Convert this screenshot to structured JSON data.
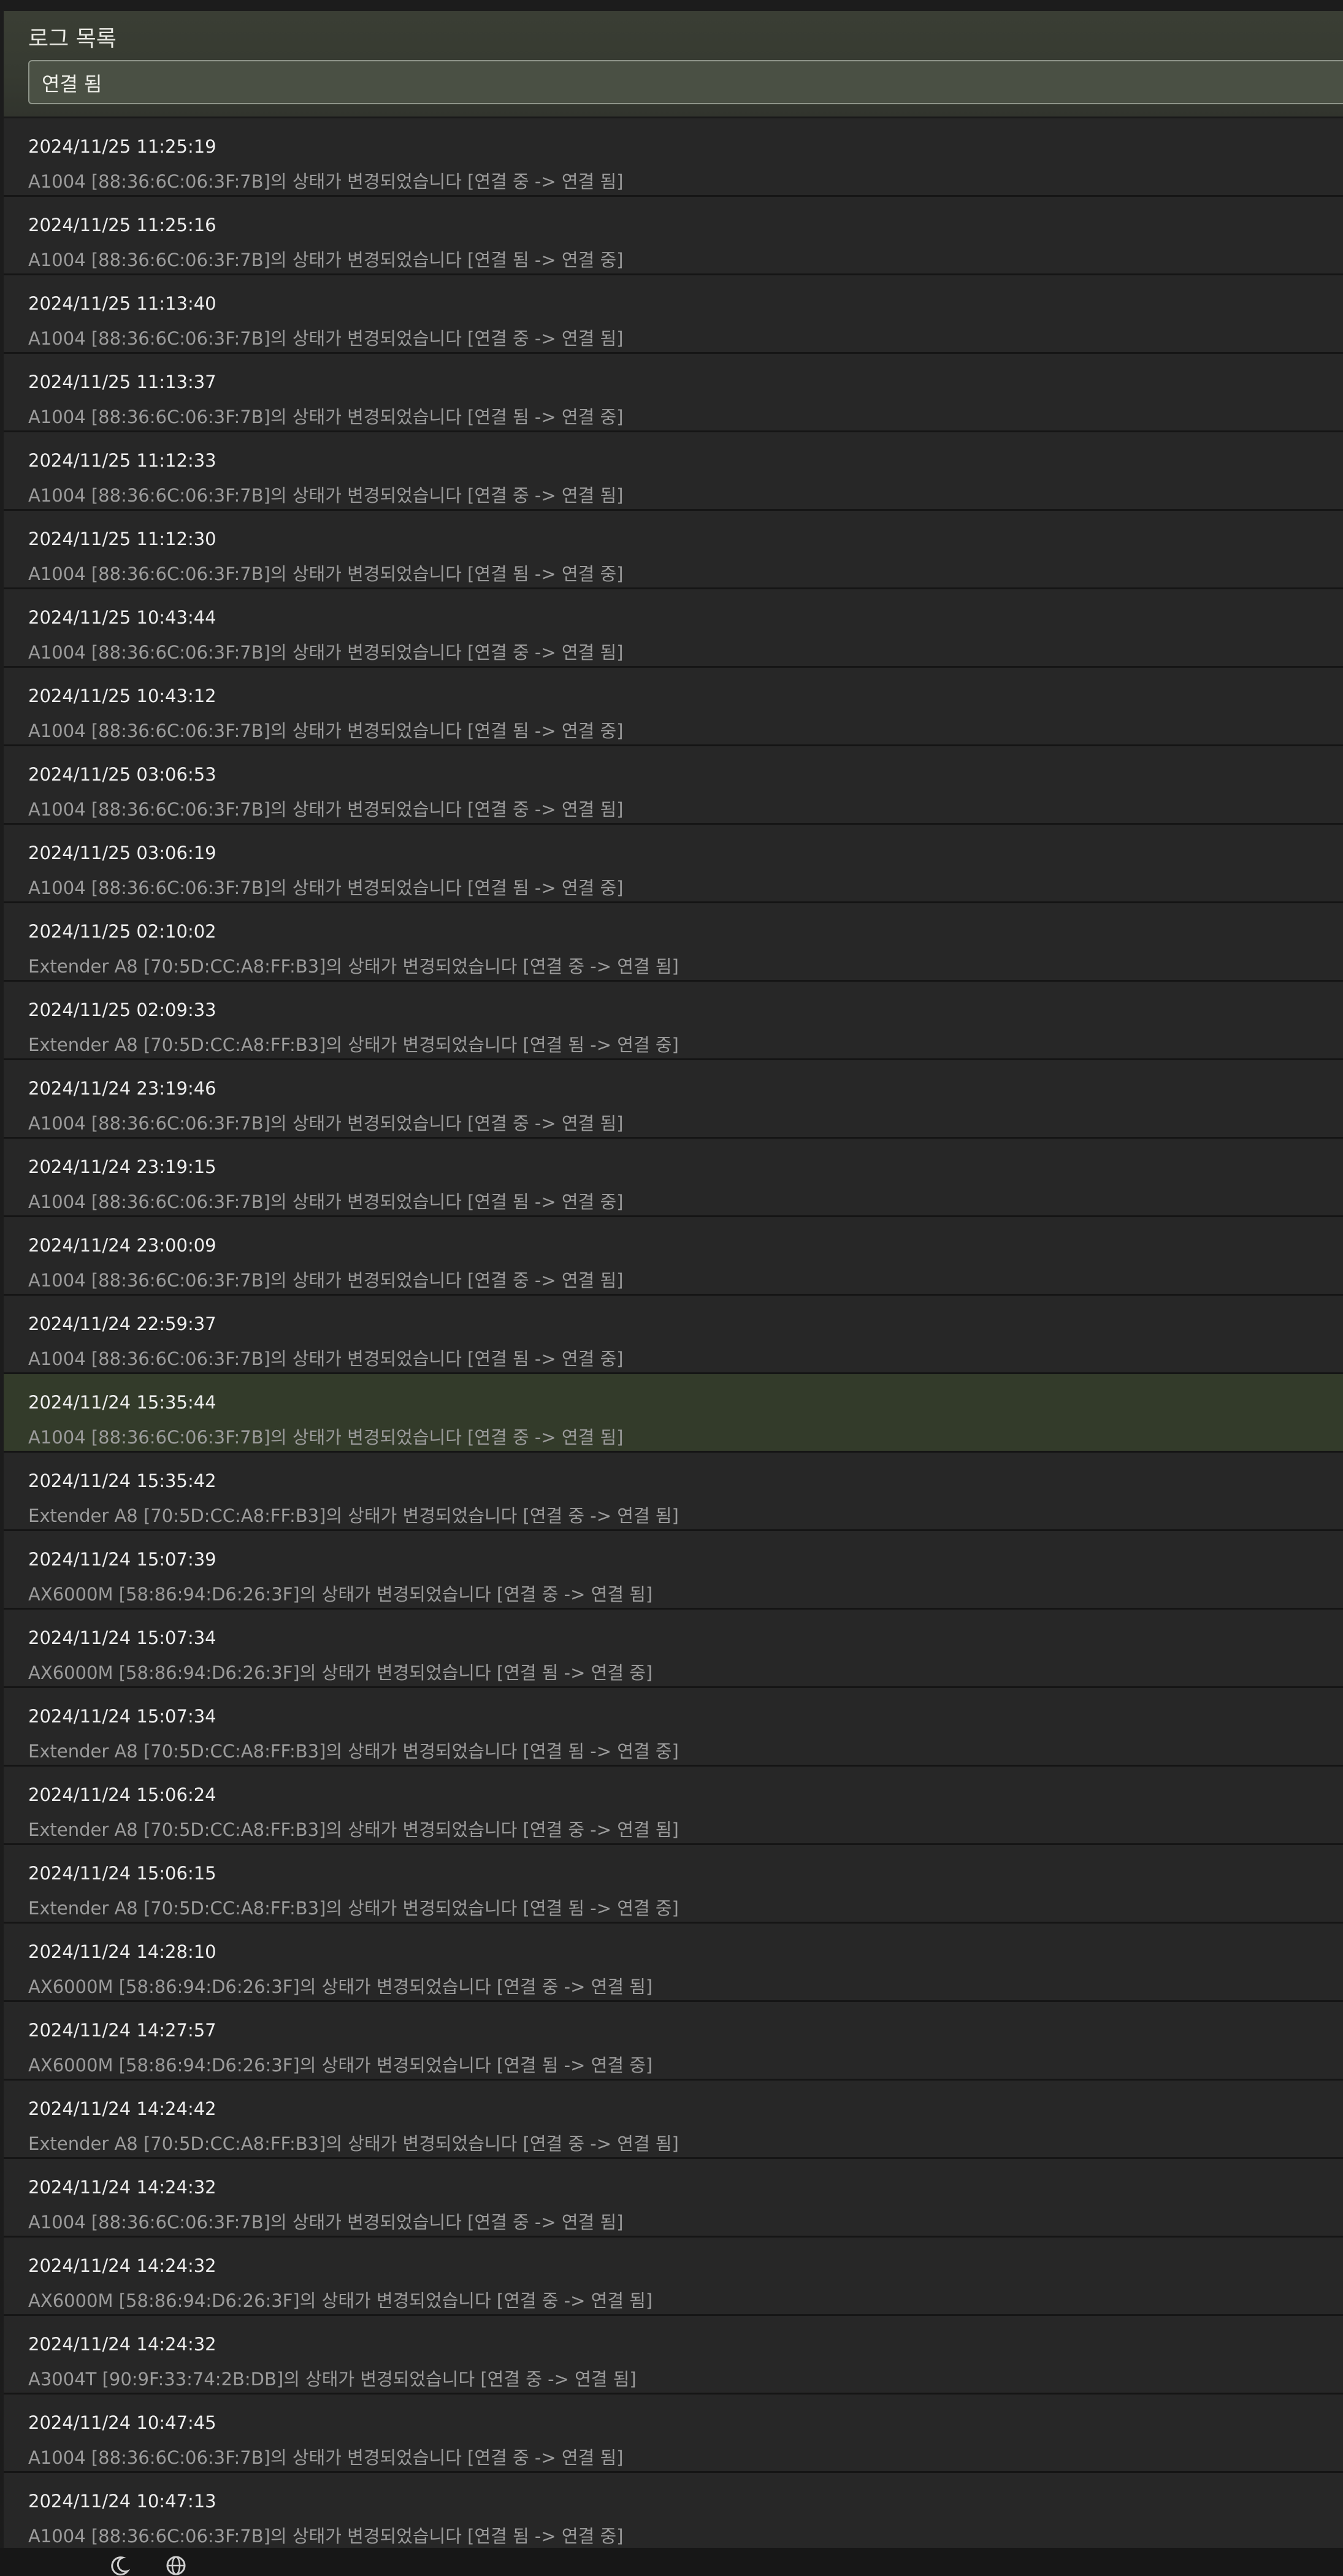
{
  "panel": {
    "title": "로그 목록",
    "filter_value": "연결 됨"
  },
  "logs": [
    {
      "time": "2024/11/25   11:25:19",
      "message": "A1004 [88:36:6C:06:3F:7B]의 상태가 변경되었습니다 [연결 중 -> 연결 됨]",
      "selected": false
    },
    {
      "time": "2024/11/25   11:25:16",
      "message": "A1004 [88:36:6C:06:3F:7B]의 상태가 변경되었습니다 [연결 됨 -> 연결 중]",
      "selected": false
    },
    {
      "time": "2024/11/25   11:13:40",
      "message": "A1004 [88:36:6C:06:3F:7B]의 상태가 변경되었습니다 [연결 중 -> 연결 됨]",
      "selected": false
    },
    {
      "time": "2024/11/25   11:13:37",
      "message": "A1004 [88:36:6C:06:3F:7B]의 상태가 변경되었습니다 [연결 됨 -> 연결 중]",
      "selected": false
    },
    {
      "time": "2024/11/25   11:12:33",
      "message": "A1004 [88:36:6C:06:3F:7B]의 상태가 변경되었습니다 [연결 중 -> 연결 됨]",
      "selected": false
    },
    {
      "time": "2024/11/25   11:12:30",
      "message": "A1004 [88:36:6C:06:3F:7B]의 상태가 변경되었습니다 [연결 됨 -> 연결 중]",
      "selected": false
    },
    {
      "time": "2024/11/25   10:43:44",
      "message": "A1004 [88:36:6C:06:3F:7B]의 상태가 변경되었습니다 [연결 중 -> 연결 됨]",
      "selected": false
    },
    {
      "time": "2024/11/25   10:43:12",
      "message": "A1004 [88:36:6C:06:3F:7B]의 상태가 변경되었습니다 [연결 됨 -> 연결 중]",
      "selected": false
    },
    {
      "time": "2024/11/25   03:06:53",
      "message": "A1004 [88:36:6C:06:3F:7B]의 상태가 변경되었습니다 [연결 중 -> 연결 됨]",
      "selected": false
    },
    {
      "time": "2024/11/25   03:06:19",
      "message": "A1004 [88:36:6C:06:3F:7B]의 상태가 변경되었습니다 [연결 됨 -> 연결 중]",
      "selected": false
    },
    {
      "time": "2024/11/25   02:10:02",
      "message": "Extender A8 [70:5D:CC:A8:FF:B3]의 상태가 변경되었습니다 [연결 중 -> 연결 됨]",
      "selected": false
    },
    {
      "time": "2024/11/25   02:09:33",
      "message": "Extender A8 [70:5D:CC:A8:FF:B3]의 상태가 변경되었습니다 [연결 됨 -> 연결 중]",
      "selected": false
    },
    {
      "time": "2024/11/24   23:19:46",
      "message": "A1004 [88:36:6C:06:3F:7B]의 상태가 변경되었습니다 [연결 중 -> 연결 됨]",
      "selected": false
    },
    {
      "time": "2024/11/24   23:19:15",
      "message": "A1004 [88:36:6C:06:3F:7B]의 상태가 변경되었습니다 [연결 됨 -> 연결 중]",
      "selected": false
    },
    {
      "time": "2024/11/24   23:00:09",
      "message": "A1004 [88:36:6C:06:3F:7B]의 상태가 변경되었습니다 [연결 중 -> 연결 됨]",
      "selected": false
    },
    {
      "time": "2024/11/24   22:59:37",
      "message": "A1004 [88:36:6C:06:3F:7B]의 상태가 변경되었습니다 [연결 됨 -> 연결 중]",
      "selected": false
    },
    {
      "time": "2024/11/24   15:35:44",
      "message": "A1004 [88:36:6C:06:3F:7B]의 상태가 변경되었습니다 [연결 중 -> 연결 됨]",
      "selected": true
    },
    {
      "time": "2024/11/24   15:35:42",
      "message": "Extender A8 [70:5D:CC:A8:FF:B3]의 상태가 변경되었습니다 [연결 중 -> 연결 됨]",
      "selected": false
    },
    {
      "time": "2024/11/24   15:07:39",
      "message": "AX6000M [58:86:94:D6:26:3F]의 상태가 변경되었습니다 [연결 중 -> 연결 됨]",
      "selected": false
    },
    {
      "time": "2024/11/24   15:07:34",
      "message": "AX6000M [58:86:94:D6:26:3F]의 상태가 변경되었습니다 [연결 됨 -> 연결 중]",
      "selected": false
    },
    {
      "time": "2024/11/24   15:07:34",
      "message": "Extender A8 [70:5D:CC:A8:FF:B3]의 상태가 변경되었습니다 [연결 됨 -> 연결 중]",
      "selected": false
    },
    {
      "time": "2024/11/24   15:06:24",
      "message": "Extender A8 [70:5D:CC:A8:FF:B3]의 상태가 변경되었습니다 [연결 중 -> 연결 됨]",
      "selected": false
    },
    {
      "time": "2024/11/24   15:06:15",
      "message": "Extender A8 [70:5D:CC:A8:FF:B3]의 상태가 변경되었습니다 [연결 됨 -> 연결 중]",
      "selected": false
    },
    {
      "time": "2024/11/24   14:28:10",
      "message": "AX6000M [58:86:94:D6:26:3F]의 상태가 변경되었습니다 [연결 중 -> 연결 됨]",
      "selected": false
    },
    {
      "time": "2024/11/24   14:27:57",
      "message": "AX6000M [58:86:94:D6:26:3F]의 상태가 변경되었습니다 [연결 됨 -> 연결 중]",
      "selected": false
    },
    {
      "time": "2024/11/24   14:24:42",
      "message": "Extender A8 [70:5D:CC:A8:FF:B3]의 상태가 변경되었습니다 [연결 중 -> 연결 됨]",
      "selected": false
    },
    {
      "time": "2024/11/24   14:24:32",
      "message": "A1004 [88:36:6C:06:3F:7B]의 상태가 변경되었습니다 [연결 중 -> 연결 됨]",
      "selected": false
    },
    {
      "time": "2024/11/24   14:24:32",
      "message": "AX6000M [58:86:94:D6:26:3F]의 상태가 변경되었습니다 [연결 중 -> 연결 됨]",
      "selected": false
    },
    {
      "time": "2024/11/24   14:24:32",
      "message": "A3004T [90:9F:33:74:2B:DB]의 상태가 변경되었습니다 [연결 중 -> 연결 됨]",
      "selected": false
    },
    {
      "time": "2024/11/24   10:47:45",
      "message": "A1004 [88:36:6C:06:3F:7B]의 상태가 변경되었습니다 [연결 중 -> 연결 됨]",
      "selected": false
    },
    {
      "time": "2024/11/24   10:47:13",
      "message": "A1004 [88:36:6C:06:3F:7B]의 상태가 변경되었습니다 [연결 됨 -> 연결 중]",
      "selected": false
    }
  ],
  "bottom_bar": {
    "icons": [
      "moon-icon",
      "globe-icon"
    ]
  },
  "colors": {
    "selected_row": "#333b2a",
    "row": "#272727",
    "header": "#363a31"
  }
}
